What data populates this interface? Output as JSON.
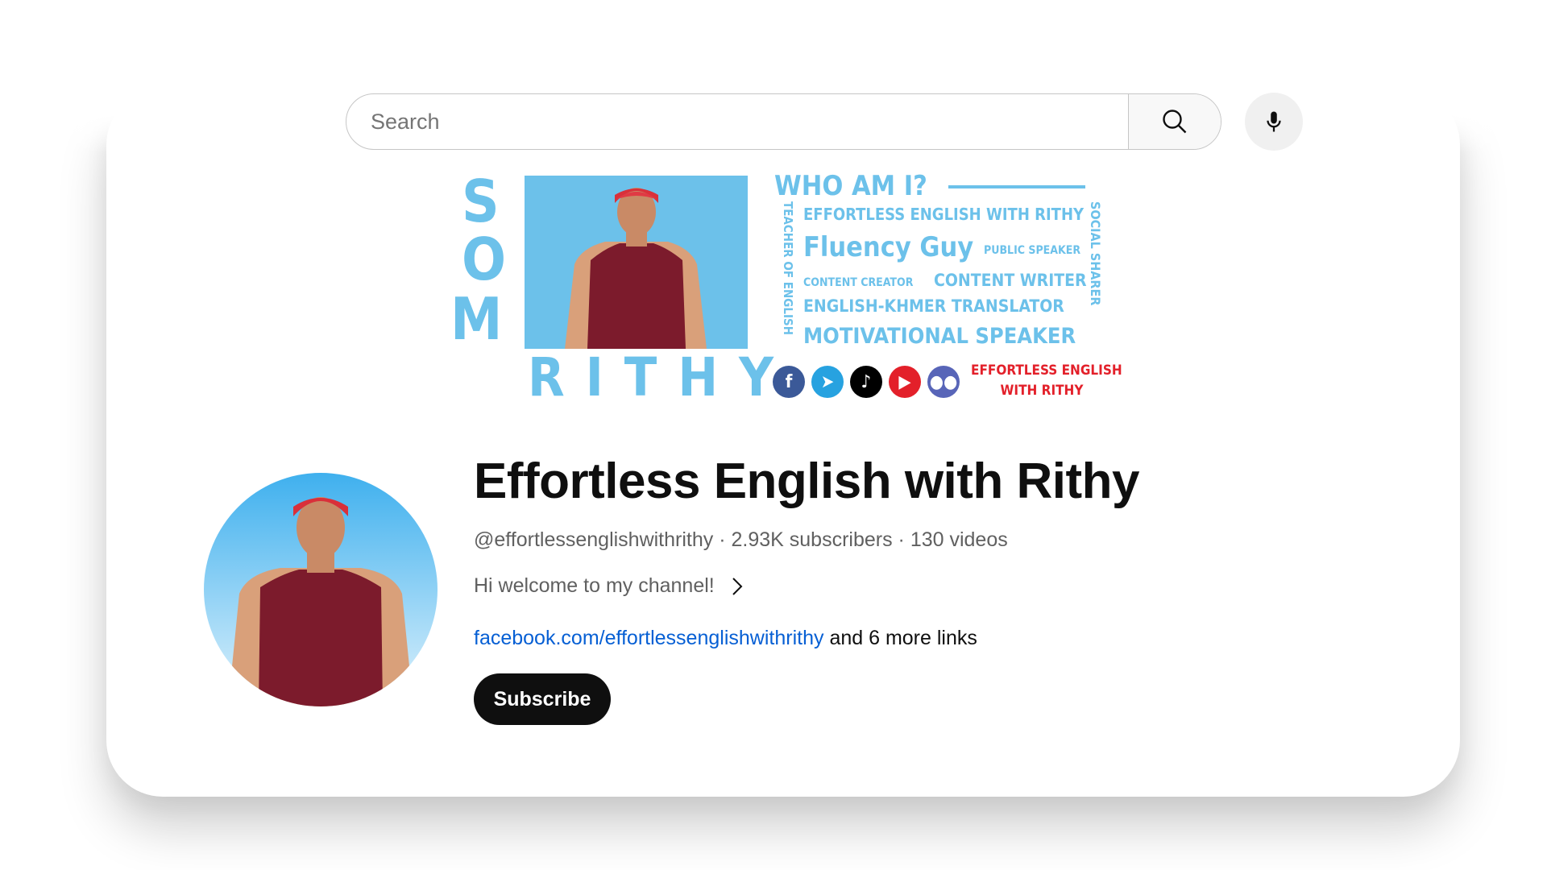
{
  "search": {
    "placeholder": "Search",
    "search_icon": "magnifier",
    "mic_icon": "microphone"
  },
  "banner": {
    "name_vertical": [
      "S",
      "O",
      "M"
    ],
    "name_horizontal": "RITHY",
    "heading": "WHO AM I?",
    "left_vertical": "TEACHER OF ENGLISH",
    "right_vertical": "SOCIAL SHARER",
    "lines": [
      "EFFORTLESS ENGLISH WITH RITHY",
      "Fluency Guy",
      "PUBLIC SPEAKER",
      "CONTENT CREATOR",
      "CONTENT WRITER",
      "ENGLISH-KHMER TRANSLATOR",
      "MOTIVATIONAL SPEAKER"
    ],
    "brand_line1": "EFFORTLESS ENGLISH",
    "brand_line2": "WITH RITHY",
    "social_icons": [
      "facebook",
      "telegram",
      "tiktok",
      "youtube",
      "discord"
    ],
    "accent": "#6cc1ea",
    "brand_color": "#e3202a"
  },
  "channel": {
    "title": "Effortless English with Rithy",
    "handle": "@effortlessenglishwithrithy",
    "subscribers": "2.93K subscribers",
    "videos": "130 videos",
    "separator": " · ",
    "description": "Hi welcome to my channel!",
    "link": "facebook.com/effortlessenglishwithrithy",
    "more_links": "and 6 more links",
    "subscribe_label": "Subscribe",
    "link_color": "#065fd4"
  }
}
